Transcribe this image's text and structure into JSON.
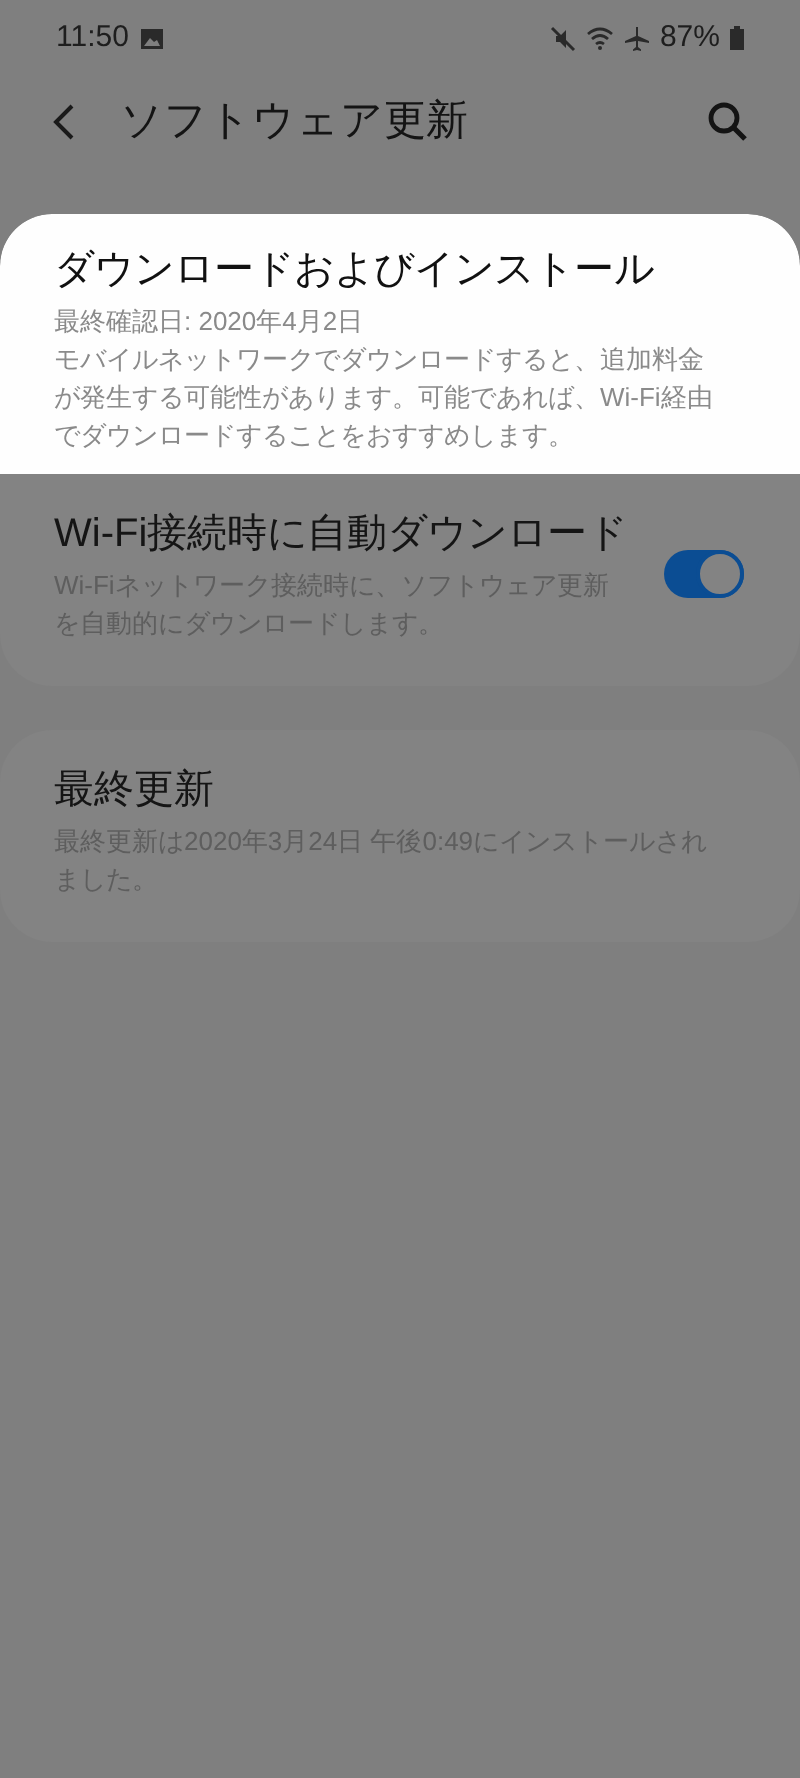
{
  "status_bar": {
    "time": "11:50",
    "battery": "87%"
  },
  "app_bar": {
    "title": "ソフトウェア更新"
  },
  "cards": [
    {
      "items": [
        {
          "kind": "text",
          "highlighted": true,
          "title": "ダウンロードおよびインストール",
          "subtitle": "最終確認日: 2020年4月2日",
          "description": "モバイルネットワークでダウンロードすると、追加料金が発生する可能性があります。可能であれば、Wi-Fi経由でダウンロードすることをおすすめします。"
        },
        {
          "kind": "switch",
          "highlighted": false,
          "title": "Wi-Fi接続時に自動ダウンロード",
          "description": "Wi-Fiネットワーク接続時に、ソフトウェア更新を自動的にダウンロードします。",
          "on": true
        }
      ]
    },
    {
      "items": [
        {
          "kind": "text",
          "highlighted": false,
          "title": "最終更新",
          "description": "最終更新は2020年3月24日 午後0:49にインストールされました。"
        }
      ]
    }
  ]
}
